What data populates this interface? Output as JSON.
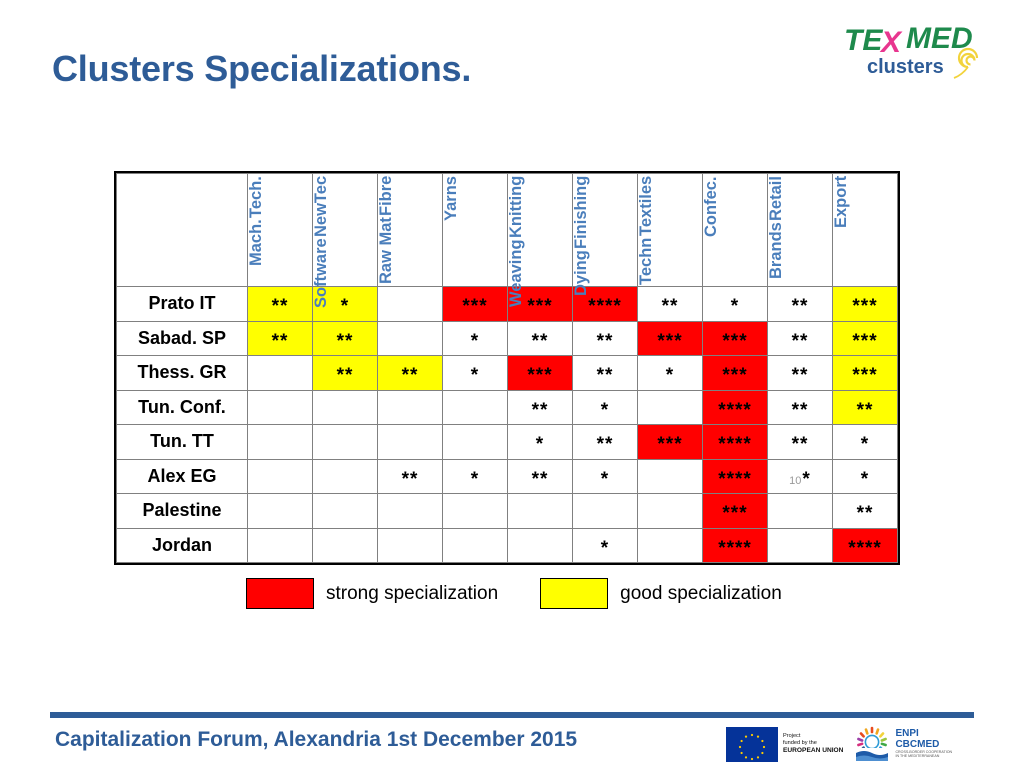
{
  "slide": {
    "title": "Clusters Specializations."
  },
  "logo": {
    "name": "texmed-clusters-logo",
    "text_tex": "TE",
    "text_x": "X",
    "text_med": "MED",
    "text_clusters": "clusters",
    "color_green": "#1E8A4C",
    "color_pink": "#E8368F",
    "color_blue": "#2E5C97",
    "color_yellow": "#F2D33C"
  },
  "table": {
    "corner_label": "",
    "columns": [
      {
        "id": "mach-tech",
        "lines": [
          "Mach.",
          "Tech."
        ]
      },
      {
        "id": "software-newtec",
        "lines": [
          "Software",
          "NewTec"
        ]
      },
      {
        "id": "raw-mat-fibre",
        "lines": [
          "Raw Mat",
          "Fibre"
        ]
      },
      {
        "id": "yarns",
        "lines": [
          "Yarns"
        ]
      },
      {
        "id": "weaving-knitting",
        "lines": [
          "Weaving",
          "Knitting"
        ]
      },
      {
        "id": "dying-finishing",
        "lines": [
          "Dying",
          "Finishing"
        ]
      },
      {
        "id": "techn-textiles",
        "lines": [
          "Techn",
          "Textiles"
        ]
      },
      {
        "id": "confec",
        "lines": [
          "Confec."
        ]
      },
      {
        "id": "brands-retail",
        "lines": [
          "Brands",
          "Retail"
        ]
      },
      {
        "id": "export",
        "lines": [
          "Export"
        ]
      }
    ],
    "rows": [
      {
        "label": "Prato IT",
        "cells": [
          {
            "stars": "**",
            "fill": "yellow"
          },
          {
            "stars": "*",
            "fill": "yellow"
          },
          {
            "stars": "",
            "fill": "white"
          },
          {
            "stars": "***",
            "fill": "red"
          },
          {
            "stars": "***",
            "fill": "red"
          },
          {
            "stars": "****",
            "fill": "red"
          },
          {
            "stars": "**",
            "fill": "white"
          },
          {
            "stars": "*",
            "fill": "white"
          },
          {
            "stars": "**",
            "fill": "white"
          },
          {
            "stars": "***",
            "fill": "yellow"
          }
        ]
      },
      {
        "label": "Sabad. SP",
        "cells": [
          {
            "stars": "**",
            "fill": "yellow"
          },
          {
            "stars": "**",
            "fill": "yellow"
          },
          {
            "stars": "",
            "fill": "white"
          },
          {
            "stars": "*",
            "fill": "white"
          },
          {
            "stars": "**",
            "fill": "white"
          },
          {
            "stars": "**",
            "fill": "white"
          },
          {
            "stars": "***",
            "fill": "red"
          },
          {
            "stars": "***",
            "fill": "red"
          },
          {
            "stars": "**",
            "fill": "white"
          },
          {
            "stars": "***",
            "fill": "yellow"
          }
        ]
      },
      {
        "label": "Thess. GR",
        "cells": [
          {
            "stars": "",
            "fill": "white"
          },
          {
            "stars": "**",
            "fill": "yellow"
          },
          {
            "stars": "**",
            "fill": "yellow"
          },
          {
            "stars": "*",
            "fill": "white"
          },
          {
            "stars": "***",
            "fill": "red"
          },
          {
            "stars": "**",
            "fill": "white"
          },
          {
            "stars": "*",
            "fill": "white"
          },
          {
            "stars": "***",
            "fill": "red"
          },
          {
            "stars": "**",
            "fill": "white"
          },
          {
            "stars": "***",
            "fill": "yellow"
          }
        ]
      },
      {
        "label": "Tun. Conf.",
        "cells": [
          {
            "stars": "",
            "fill": "white"
          },
          {
            "stars": "",
            "fill": "white"
          },
          {
            "stars": "",
            "fill": "white"
          },
          {
            "stars": "",
            "fill": "white"
          },
          {
            "stars": "**",
            "fill": "white"
          },
          {
            "stars": "*",
            "fill": "white"
          },
          {
            "stars": "",
            "fill": "white"
          },
          {
            "stars": "****",
            "fill": "red"
          },
          {
            "stars": "**",
            "fill": "white"
          },
          {
            "stars": "**",
            "fill": "yellow"
          }
        ]
      },
      {
        "label": "Tun. TT",
        "cells": [
          {
            "stars": "",
            "fill": "white"
          },
          {
            "stars": "",
            "fill": "white"
          },
          {
            "stars": "",
            "fill": "white"
          },
          {
            "stars": "",
            "fill": "white"
          },
          {
            "stars": "*",
            "fill": "white"
          },
          {
            "stars": "**",
            "fill": "white"
          },
          {
            "stars": "***",
            "fill": "red"
          },
          {
            "stars": "****",
            "fill": "red"
          },
          {
            "stars": "**",
            "fill": "white"
          },
          {
            "stars": "*",
            "fill": "white"
          }
        ]
      },
      {
        "label": "Alex EG",
        "cells": [
          {
            "stars": "",
            "fill": "white"
          },
          {
            "stars": "",
            "fill": "white"
          },
          {
            "stars": "**",
            "fill": "white"
          },
          {
            "stars": "*",
            "fill": "white"
          },
          {
            "stars": "**",
            "fill": "white"
          },
          {
            "stars": "*",
            "fill": "white"
          },
          {
            "stars": "",
            "fill": "white"
          },
          {
            "stars": "****",
            "fill": "red"
          },
          {
            "stars": "*",
            "fill": "white",
            "note": "10"
          },
          {
            "stars": "*",
            "fill": "white"
          }
        ]
      },
      {
        "label": "Palestine",
        "cells": [
          {
            "stars": "",
            "fill": "white"
          },
          {
            "stars": "",
            "fill": "white"
          },
          {
            "stars": "",
            "fill": "white"
          },
          {
            "stars": "",
            "fill": "white"
          },
          {
            "stars": "",
            "fill": "white"
          },
          {
            "stars": "",
            "fill": "white"
          },
          {
            "stars": "",
            "fill": "white"
          },
          {
            "stars": "***",
            "fill": "red"
          },
          {
            "stars": "",
            "fill": "white"
          },
          {
            "stars": "**",
            "fill": "white"
          }
        ]
      },
      {
        "label": "Jordan",
        "cells": [
          {
            "stars": "",
            "fill": "white"
          },
          {
            "stars": "",
            "fill": "white"
          },
          {
            "stars": "",
            "fill": "white"
          },
          {
            "stars": "",
            "fill": "white"
          },
          {
            "stars": "",
            "fill": "white"
          },
          {
            "stars": "*",
            "fill": "white"
          },
          {
            "stars": "",
            "fill": "white"
          },
          {
            "stars": "****",
            "fill": "red"
          },
          {
            "stars": "",
            "fill": "white"
          },
          {
            "stars": "****",
            "fill": "red"
          }
        ]
      }
    ]
  },
  "legend": {
    "strong": {
      "label": "strong specialization",
      "color": "#FF0000"
    },
    "good": {
      "label": "good specialization",
      "color": "#FFFF00"
    }
  },
  "footer": {
    "text": "Capitalization Forum, Alexandria 1st December 2015",
    "accent_color": "#2E5C97",
    "eu_logo": {
      "line1": "Project",
      "line2": "funded by the",
      "line3": "EUROPEAN UNION"
    },
    "enpi_logo": {
      "line1": "ENPI",
      "line2": "CBCMED",
      "line3": "CROSS-BORDER COOPERATION",
      "line4": "IN THE MEDITERRANEAN"
    }
  },
  "chart_data": {
    "type": "heatmap",
    "title": "Clusters Specializations.",
    "xlabel": "",
    "ylabel": "",
    "categories": [
      "Mach. Tech.",
      "Software NewTec",
      "Raw Mat Fibre",
      "Yarns",
      "Weaving Knitting",
      "Dying Finishing",
      "Techn Textiles",
      "Confec.",
      "Brands Retail",
      "Export"
    ],
    "rows": [
      "Prato IT",
      "Sabad. SP",
      "Thess. GR",
      "Tun. Conf.",
      "Tun. TT",
      "Alex EG",
      "Palestine",
      "Jordan"
    ],
    "values": [
      [
        2,
        1,
        0,
        3,
        3,
        4,
        2,
        1,
        2,
        3
      ],
      [
        2,
        2,
        0,
        1,
        2,
        2,
        3,
        3,
        2,
        3
      ],
      [
        0,
        2,
        2,
        1,
        3,
        2,
        1,
        3,
        2,
        3
      ],
      [
        0,
        0,
        0,
        0,
        2,
        1,
        0,
        4,
        2,
        2
      ],
      [
        0,
        0,
        0,
        0,
        1,
        2,
        3,
        4,
        2,
        1
      ],
      [
        0,
        0,
        2,
        1,
        2,
        1,
        0,
        4,
        1,
        1
      ],
      [
        0,
        0,
        0,
        0,
        0,
        0,
        0,
        3,
        0,
        2
      ],
      [
        0,
        0,
        0,
        0,
        0,
        1,
        0,
        4,
        0,
        4
      ]
    ],
    "fills": [
      [
        "yellow",
        "yellow",
        "white",
        "red",
        "red",
        "red",
        "white",
        "white",
        "white",
        "yellow"
      ],
      [
        "yellow",
        "yellow",
        "white",
        "white",
        "white",
        "white",
        "red",
        "red",
        "white",
        "yellow"
      ],
      [
        "white",
        "yellow",
        "yellow",
        "white",
        "red",
        "white",
        "white",
        "red",
        "white",
        "yellow"
      ],
      [
        "white",
        "white",
        "white",
        "white",
        "white",
        "white",
        "white",
        "red",
        "white",
        "yellow"
      ],
      [
        "white",
        "white",
        "white",
        "white",
        "white",
        "white",
        "red",
        "red",
        "white",
        "white"
      ],
      [
        "white",
        "white",
        "white",
        "white",
        "white",
        "white",
        "white",
        "red",
        "white",
        "white"
      ],
      [
        "white",
        "white",
        "white",
        "white",
        "white",
        "white",
        "white",
        "red",
        "white",
        "white"
      ],
      [
        "white",
        "white",
        "white",
        "white",
        "white",
        "white",
        "white",
        "red",
        "white",
        "red"
      ]
    ],
    "legend": [
      {
        "color": "#FF0000",
        "label": "strong specialization"
      },
      {
        "color": "#FFFF00",
        "label": "good specialization"
      }
    ],
    "grid": true,
    "legend_position": "bottom"
  }
}
